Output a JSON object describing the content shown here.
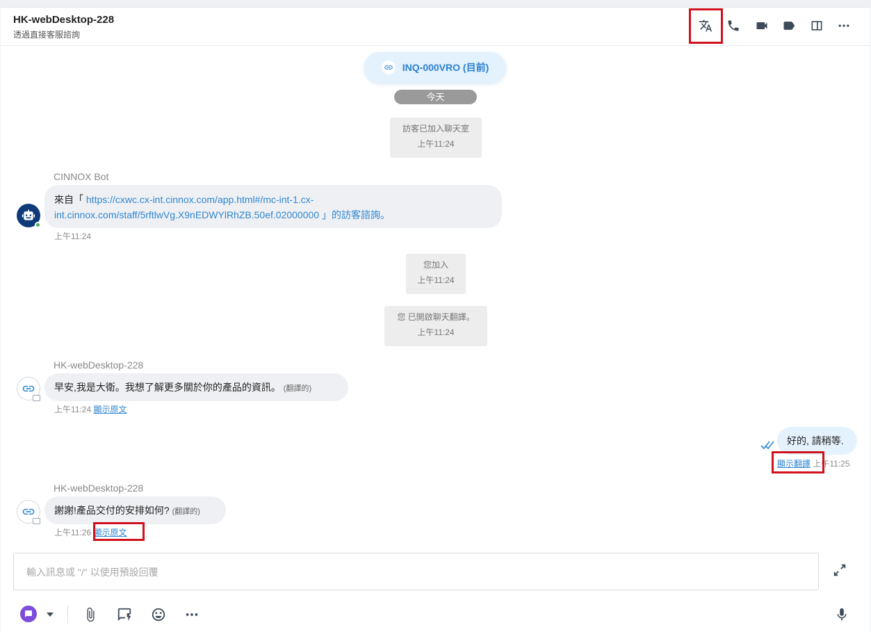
{
  "header": {
    "title": "HK-webDesktop-228",
    "subtitle": "透過直接客服諮詢"
  },
  "thread": {
    "inquiry_pill": "INQ-000VRO (目前)",
    "date_divider": "今天",
    "system_1": {
      "text": "訪客已加入聊天室",
      "time": "上午11:24"
    },
    "bot_message": {
      "sender": "CINNOX Bot",
      "prefix": "來自「 ",
      "link_line1": "https://cxwc.cx-int.cinnox.com/app.html#/mc-int-1.cx-",
      "link_line2": "int.cinnox.com/staff/5rftlwVg.X9nEDWYlRhZB.50ef.02000000",
      "suffix": " 」的訪客諮詢。",
      "time": "上午11:24"
    },
    "system_2": {
      "text": "您加入",
      "time": "上午11:24"
    },
    "system_3": {
      "text": "您 已開啟聊天翻譯。",
      "time": "上午11:24"
    },
    "visitor_message_1": {
      "sender": "HK-webDesktop-228",
      "text": "早安,我是大衛。我想了解更多關於你的產品的資訊。",
      "tag": "(翻譯的)",
      "time": "上午11:24",
      "action": "顯示原文"
    },
    "agent_message": {
      "text": "好的, 請稍等.",
      "action": "顯示翻譯",
      "time": "上午11:25"
    },
    "visitor_message_2": {
      "sender": "HK-webDesktop-228",
      "text": "謝謝!產品交付的安排如何?",
      "tag": "(翻譯的)",
      "time": "上午11:26",
      "action": "顯示原文"
    }
  },
  "composer": {
    "placeholder": "輸入訊息或 \"/\" 以使用預設回覆"
  },
  "icons": {
    "header": [
      "translate-icon",
      "phone-icon",
      "video-icon",
      "tag-icon",
      "side-panel-icon",
      "more-icon"
    ],
    "toolbar": [
      "message-type-icon",
      "attach-icon",
      "quick-reply-icon",
      "emoji-icon",
      "more-icon",
      "microphone-icon"
    ]
  },
  "colors": {
    "accent": "#2f86d0",
    "highlight_box": "#d0111b",
    "bot_avatar": "#0f3a7a",
    "message_type": "#7c4ddb"
  }
}
